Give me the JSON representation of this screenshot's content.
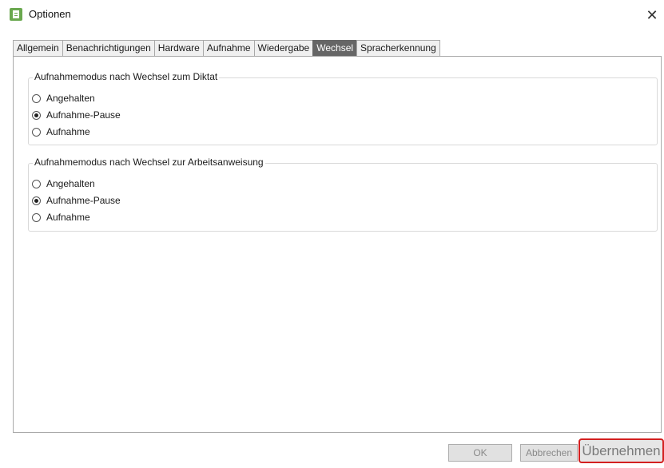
{
  "window": {
    "title": "Optionen",
    "icon": "app-icon",
    "close_glyph": "✕"
  },
  "tabs": [
    {
      "label": "Allgemein",
      "active": false
    },
    {
      "label": "Benachrichtigungen",
      "active": false
    },
    {
      "label": "Hardware",
      "active": false
    },
    {
      "label": "Aufnahme",
      "active": false
    },
    {
      "label": "Wiedergabe",
      "active": false
    },
    {
      "label": "Wechsel",
      "active": true
    },
    {
      "label": "Spracherkennung",
      "active": false
    }
  ],
  "groups": [
    {
      "title": "Aufnahmemodus nach Wechsel zum Diktat",
      "options": [
        {
          "label": "Angehalten",
          "checked": false
        },
        {
          "label": "Aufnahme-Pause",
          "checked": true
        },
        {
          "label": "Aufnahme",
          "checked": false
        }
      ]
    },
    {
      "title": "Aufnahmemodus nach Wechsel zur Arbeitsanweisung",
      "options": [
        {
          "label": "Angehalten",
          "checked": false
        },
        {
          "label": "Aufnahme-Pause",
          "checked": true
        },
        {
          "label": "Aufnahme",
          "checked": false
        }
      ]
    }
  ],
  "buttons": {
    "ok": "OK",
    "cancel": "Abbrechen",
    "apply": "Übernehmen"
  },
  "colors": {
    "active_tab": "#666666",
    "highlight": "#d32020",
    "icon_green": "#6aa84f"
  }
}
